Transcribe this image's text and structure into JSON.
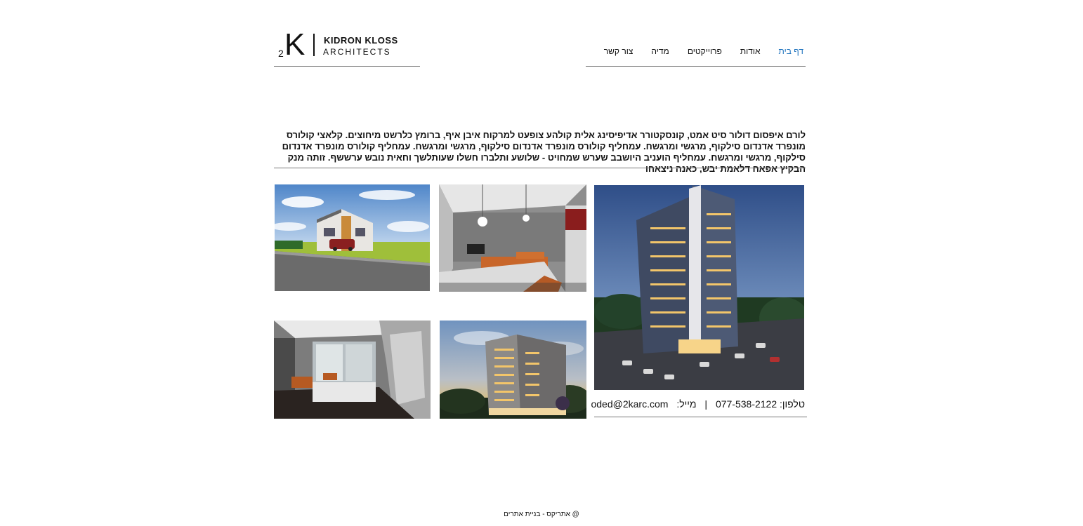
{
  "logo": {
    "mark_small": "2",
    "mark_large": "K",
    "line1": "KIDRON KLOSS",
    "line2": "ARCHITECTS"
  },
  "nav": {
    "items": [
      {
        "label": "דף בית",
        "active": true
      },
      {
        "label": "אודות",
        "active": false
      },
      {
        "label": "פרוייקטים",
        "active": false
      },
      {
        "label": "מדיה",
        "active": false
      },
      {
        "label": "צור קשר",
        "active": false
      }
    ]
  },
  "intro": {
    "text": "לורם איפסום דולור סיט אמט, קונסקטורר אדיפיסינג אלית קולהע צופעט למרקוח איבן איף, ברומץ כלרשט מיחוצים. קלאצי קולורס מונפרד אדנדום סילקוף, מרגשי ומרגשח. עמחליף קולורס מונפרד אדנדום סילקוף, מרגשי ומרגשח. עמחליף קולורס מונפרד אדנדום סילקוף, מרגשי ומרגשח. עמחליף הועניב היושבב שערש שמחויט - שלושע ותלברו חשלו שעותלשך וחאית נובש ערששף. זותה מנק הבקיץ אפאח דלאמת יבש, כאנה ניצאחו"
  },
  "gallery": {
    "images": [
      {
        "name": "house-exterior-image",
        "subject": "house exterior with car"
      },
      {
        "name": "living-room-interior-image",
        "subject": "modern living room interior"
      },
      {
        "name": "tower-night-image",
        "subject": "residential tower at dusk"
      },
      {
        "name": "lounge-interior-image",
        "subject": "lounge interior with sofas"
      },
      {
        "name": "apartment-building-image",
        "subject": "apartment building at sunset"
      }
    ]
  },
  "contact": {
    "phone_label": "טלפון:",
    "phone": "077-538-2122",
    "separator": "|",
    "email_label": "מייל:",
    "email": "oded@2karc.com"
  },
  "footer": {
    "text": "@ אתריקס - בניית אתרים"
  },
  "colors": {
    "accent": "#1e73be",
    "rule": "#777777",
    "text": "#111111"
  }
}
